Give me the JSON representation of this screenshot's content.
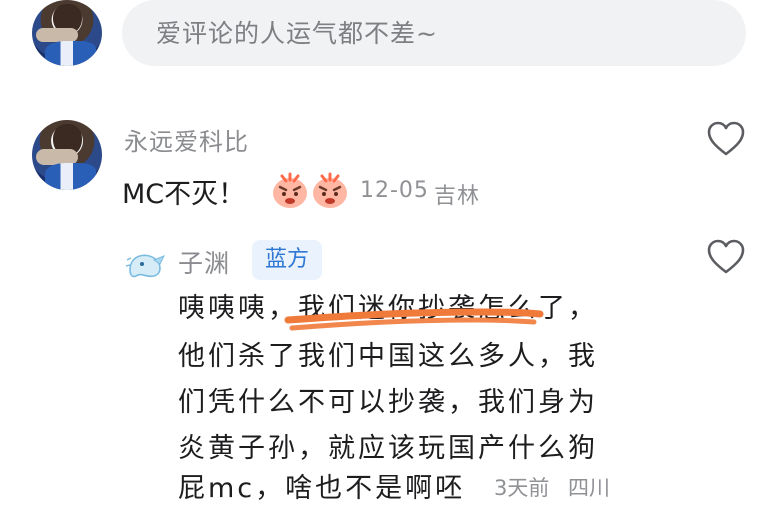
{
  "input": {
    "placeholder": "爱评论的人运气都不差~"
  },
  "comment": {
    "username": "永远爱科比",
    "text": "MC不灭！",
    "emoji": "angry-face-emoji",
    "date": "12-05",
    "location": "吉林"
  },
  "reply": {
    "username": "子渊",
    "badge": "蓝方",
    "lines": [
      "咦咦咦，我们迷你抄袭怎么了，",
      "他们杀了我们中国这么多人，我",
      "们凭什么不可以抄袭，我们身为",
      "炎黄子孙，就应该玩国产什么狗",
      "屁mc，啥也不是啊呸"
    ],
    "time": "3天前",
    "location": "四川"
  },
  "colors": {
    "scribble": "#f07a3a",
    "badge_text": "#2f78d4",
    "badge_bg": "#e9f2fd"
  }
}
